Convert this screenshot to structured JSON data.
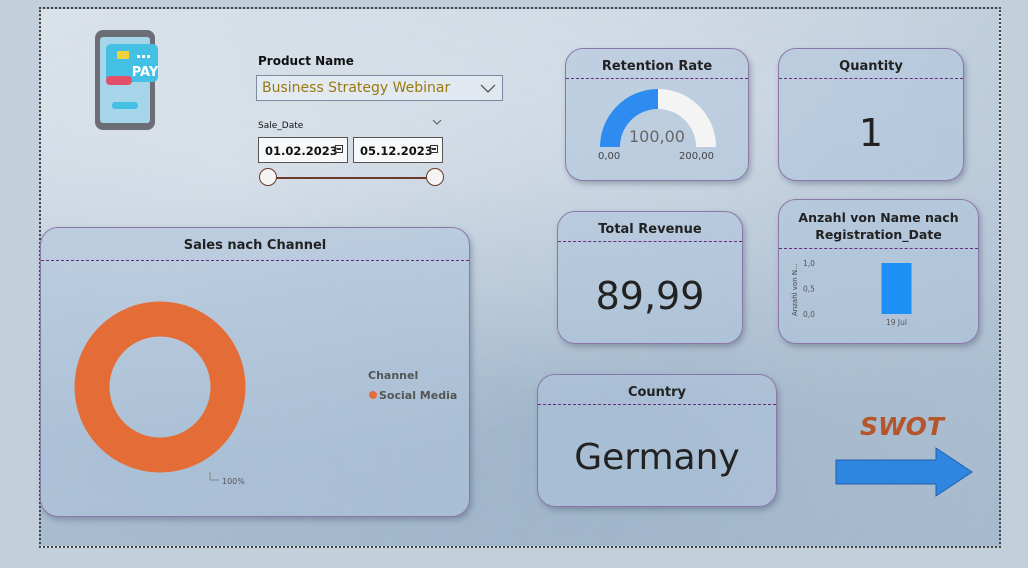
{
  "filters": {
    "product": {
      "title": "Product Name",
      "selected": "Business Strategy Webinar"
    },
    "date": {
      "title": "Sale_Date",
      "start": "01.02.2023",
      "end": "05.12.2023"
    }
  },
  "retention": {
    "title": "Retention Rate",
    "value": 100,
    "value_label": "100,00",
    "min_label": "0,00",
    "max_label": "200,00"
  },
  "quantity": {
    "title": "Quantity",
    "value": "1"
  },
  "revenue": {
    "title": "Total Revenue",
    "value": "89,99"
  },
  "registration": {
    "title_line1": "Anzahl von Name nach",
    "title_line2": "Registration_Date",
    "ylabel": "Anzahl von N..."
  },
  "country": {
    "title": "Country",
    "value": "Germany"
  },
  "sales_channel": {
    "title": "Sales nach Channel",
    "legend_title": "Channel"
  },
  "swot": {
    "label": "SWOT"
  },
  "colors": {
    "donut": "#e46d37",
    "gauge": "#2e8cf0",
    "bar": "#1e8ff5",
    "arrow": "#2e86e0",
    "swot": "#b5552b"
  },
  "chart_data": [
    {
      "type": "pie",
      "title": "Sales nach Channel",
      "labels": [
        "Social Media"
      ],
      "values": [
        100
      ],
      "data_labels": [
        "100%"
      ],
      "legend_title": "Channel",
      "legend": "right"
    },
    {
      "type": "bar",
      "categories": [
        "19 Jul"
      ],
      "series": [
        {
          "values": [
            1.0
          ]
        }
      ],
      "ylabel": "Anzahl von N...",
      "yticks": [
        "0,0",
        "0,5",
        "1,0"
      ],
      "ylim": [
        0,
        1
      ]
    }
  ]
}
